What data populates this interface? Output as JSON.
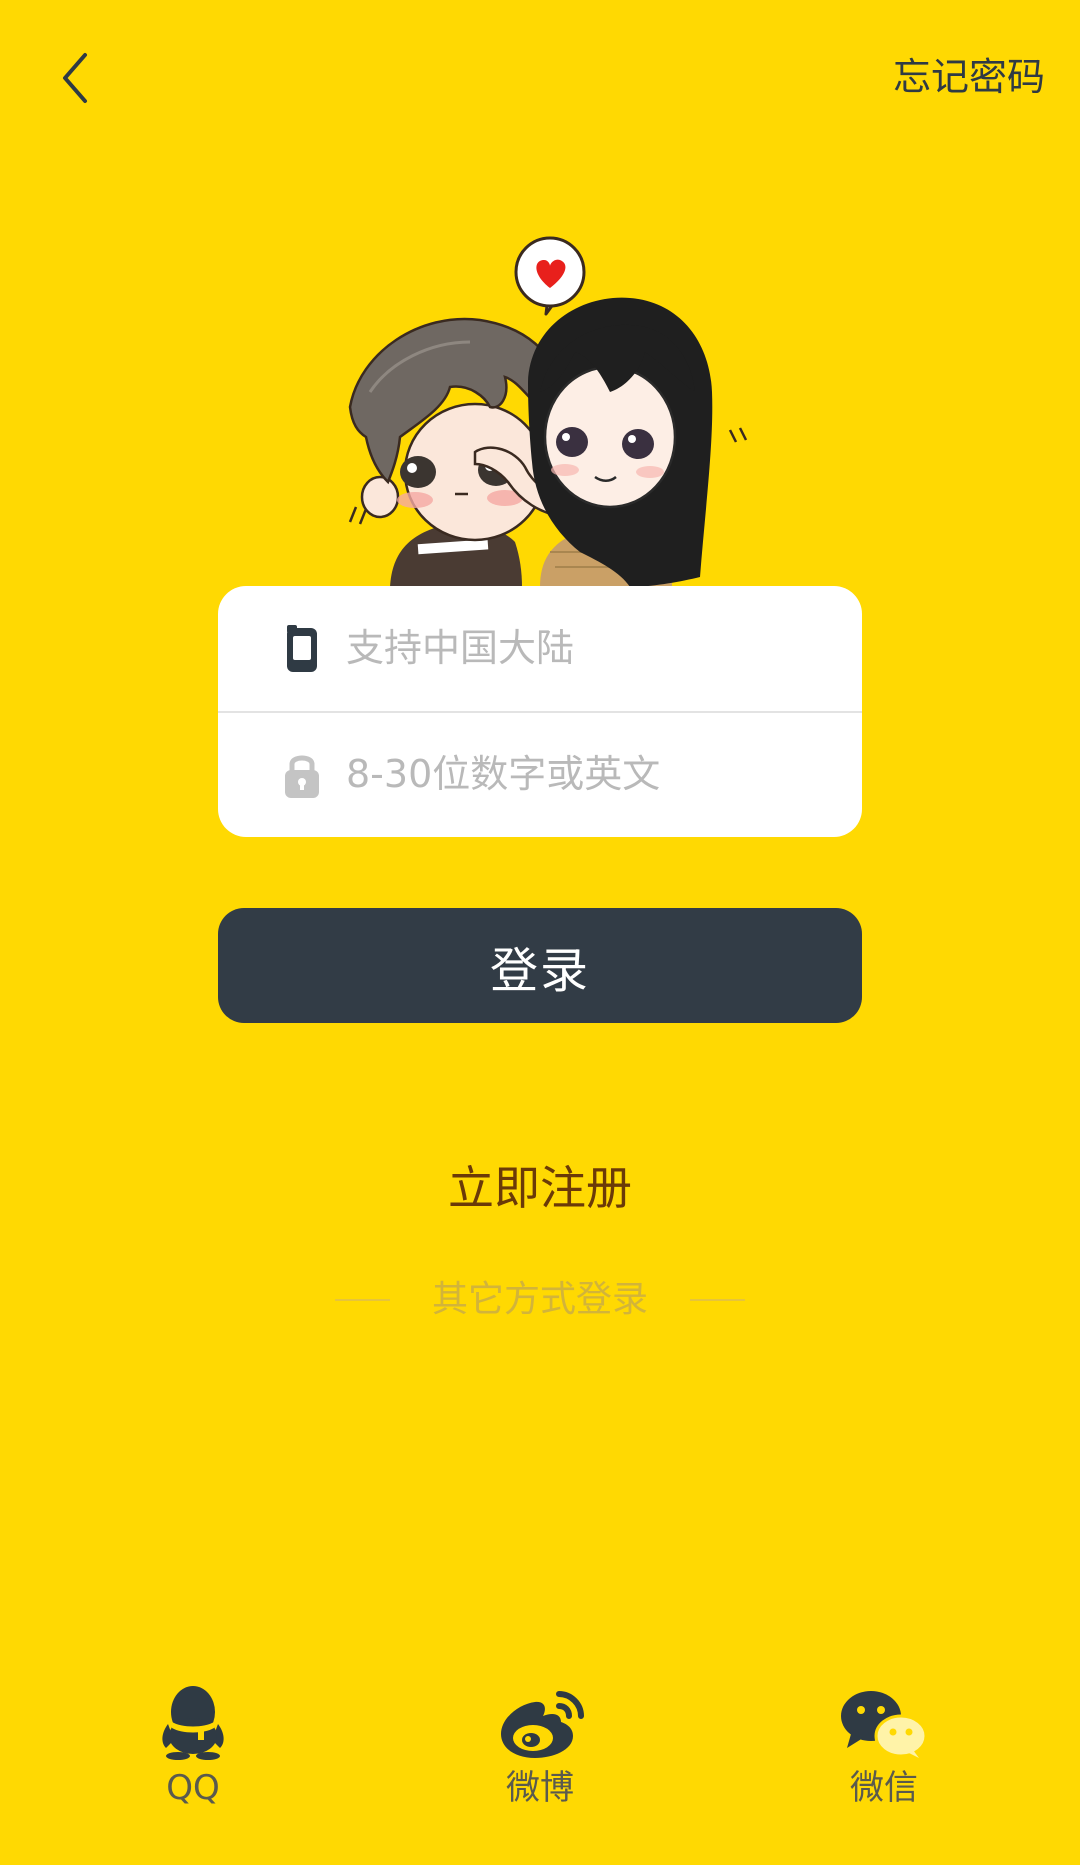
{
  "topbar": {
    "back_icon": "chevron-left-icon",
    "forgot_password": "忘记密码"
  },
  "form": {
    "phone_placeholder": "支持中国大陆",
    "phone_value": "",
    "phone_icon": "phone-icon",
    "password_placeholder": "8-30位数字或英文",
    "password_value": "",
    "password_icon": "lock-icon"
  },
  "login_button": "登录",
  "register_link": "立即注册",
  "other_login_label": "其它方式登录",
  "social": [
    {
      "label": "QQ",
      "icon": "qq-icon"
    },
    {
      "label": "微博",
      "icon": "weibo-icon"
    },
    {
      "label": "微信",
      "icon": "wechat-icon"
    }
  ],
  "colors": {
    "background": "#FFD902",
    "button": "#323C46",
    "register_text": "#6B3A08",
    "placeholder": "#B9B9B9",
    "icon_dark": "#2F3A44"
  }
}
